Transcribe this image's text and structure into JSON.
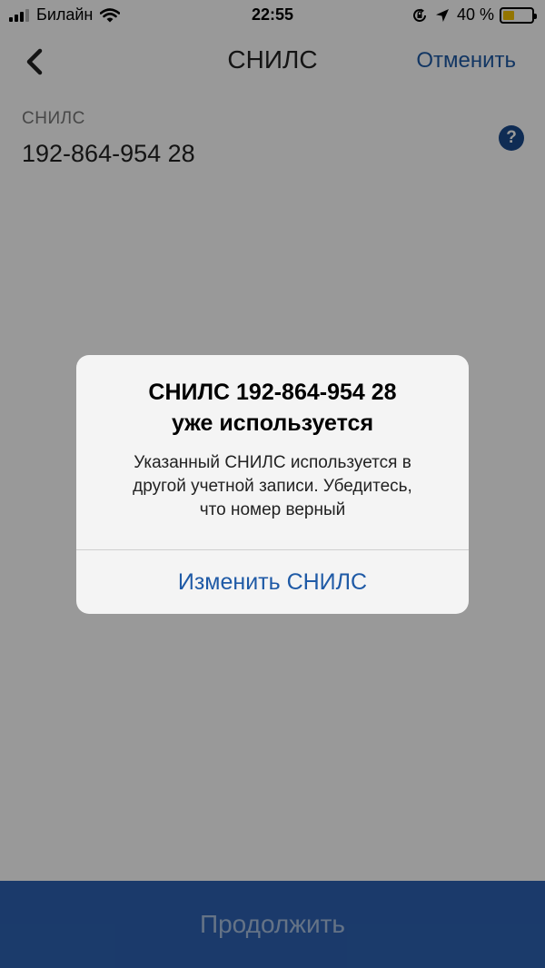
{
  "status_bar": {
    "carrier": "Билайн",
    "time": "22:55",
    "battery_text": "40 %",
    "battery_level": 0.4,
    "icons": [
      "signal-icon",
      "wifi-icon",
      "orientation-lock-icon",
      "location-arrow-icon",
      "battery-icon"
    ]
  },
  "nav": {
    "title": "СНИЛС",
    "cancel_label": "Отменить"
  },
  "field": {
    "label": "СНИЛС",
    "value": "192-864-954 28",
    "help_glyph": "?"
  },
  "alert": {
    "title_line1": "СНИЛС 192-864-954 28",
    "title_line2": "уже используется",
    "message_line1": "Указанный СНИЛС используется в",
    "message_line2": "другой учетной записи. Убедитесь,",
    "message_line3": "что номер верный",
    "action_label": "Изменить СНИЛС"
  },
  "footer": {
    "continue_label": "Продолжить"
  },
  "colors": {
    "accent": "#1f5aa6",
    "button_bg": "#2d62b3",
    "help_icon": "#1a4a8c",
    "battery": "#f5c400"
  }
}
